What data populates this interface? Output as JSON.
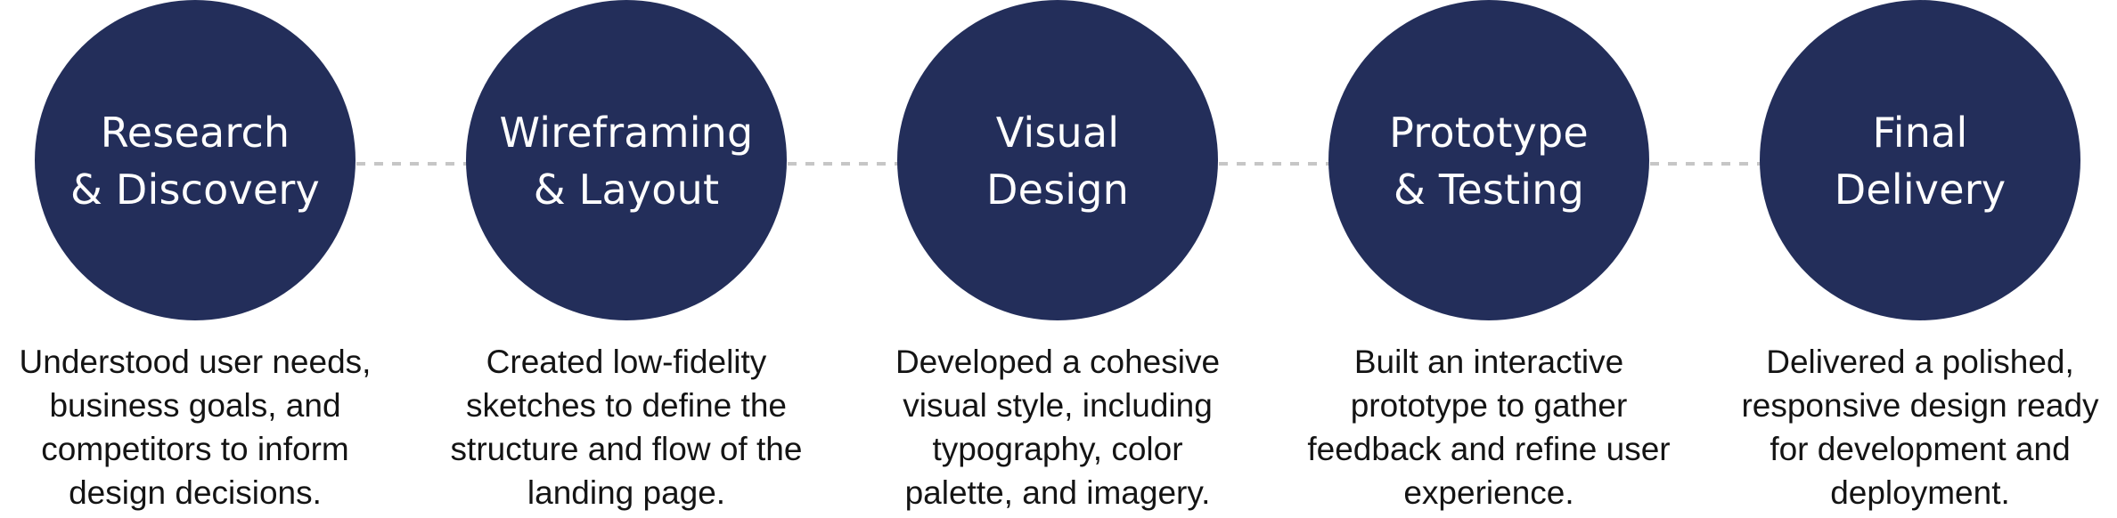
{
  "colors": {
    "circle_fill": "#232e5a",
    "title_text": "#ffffff",
    "description_text": "#141414",
    "connector": "#c6c6c6",
    "background": "#ffffff"
  },
  "steps": [
    {
      "title_lines": [
        "Research",
        "& Discovery"
      ],
      "description_lines": [
        "Understood user needs,",
        "business goals, and",
        "competitors to inform",
        "design decisions."
      ]
    },
    {
      "title_lines": [
        "Wireframing",
        "& Layout"
      ],
      "description_lines": [
        "Created low-fidelity",
        "sketches to define the",
        "structure and flow of the",
        "landing page."
      ]
    },
    {
      "title_lines": [
        "Visual",
        "Design"
      ],
      "description_lines": [
        "Developed a cohesive",
        "visual style, including",
        "typography, color",
        "palette, and imagery."
      ]
    },
    {
      "title_lines": [
        "Prototype",
        "& Testing"
      ],
      "description_lines": [
        "Built an interactive",
        "prototype to gather",
        "feedback and refine user",
        "experience."
      ]
    },
    {
      "title_lines": [
        "Final",
        "Delivery"
      ],
      "description_lines": [
        "Delivered a polished,",
        "responsive design ready",
        "for development and",
        "deployment."
      ]
    }
  ]
}
